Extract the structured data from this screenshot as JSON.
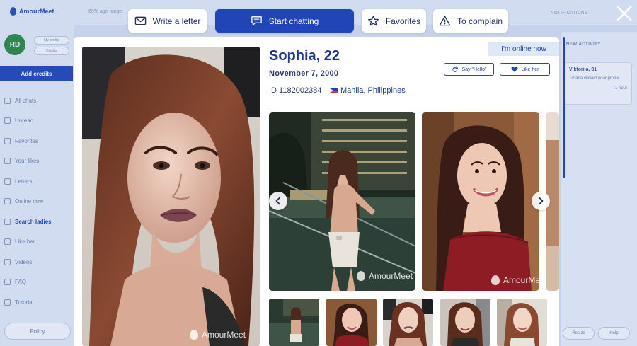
{
  "background": {
    "logo_text": "AmourMeet",
    "avatar_initials": "RD",
    "mini_buttons": [
      "My profile",
      "Credits"
    ],
    "add_credits_label": "Add credits",
    "menu_items": [
      "All chats",
      "Unread",
      "Favorites",
      "Your likes",
      "Letters",
      "Online now",
      "Search ladies",
      "Like her",
      "Videos",
      "FAQ",
      "Tutorial"
    ],
    "policy_label": "Policy",
    "topbar_text": "60% age range",
    "topbar_right": "NOTIFICATIONS",
    "right_panel_title": "NEW ACTIVITY",
    "right_card_title": "Viktoriia, 31",
    "right_card_text": "Tiziana viewed your profile",
    "right_card_time": "1 hour",
    "right_buttons": [
      "Resize",
      "Help"
    ]
  },
  "actions": {
    "write_letter": "Write a letter",
    "start_chatting": "Start chatting",
    "favorites": "Favorites",
    "complain": "To complain"
  },
  "profile": {
    "name_age": "Sophia, 22",
    "birth_date": "November 7, 2000",
    "id_text": "ID 1182002384",
    "location": "Manila, Philippines",
    "online_status": "I'm online now",
    "say_hello": "Say \"Hello\"",
    "like_her": "Like her"
  },
  "watermark": "AmourMeet",
  "icons": {
    "write_letter": "envelope-icon",
    "start_chatting": "chat-bubble-icon",
    "favorites": "star-icon",
    "complain": "warning-icon",
    "close": "close-icon",
    "say_hello": "wave-hand-icon",
    "like_her": "heart-icon"
  },
  "colors": {
    "primary": "#2145b7",
    "name": "#1d3a8f",
    "online_badge": "#dfe8f7"
  }
}
